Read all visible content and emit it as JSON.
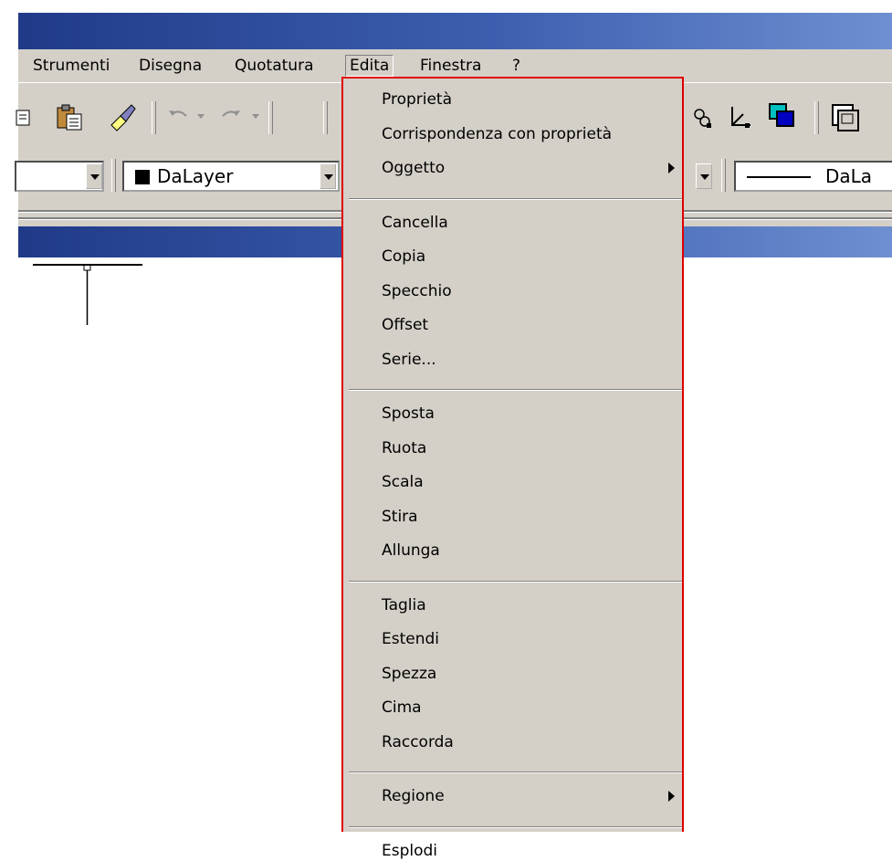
{
  "menubar": {
    "items": [
      {
        "label": "Strumenti"
      },
      {
        "label": "Disegna"
      },
      {
        "label": "Quotatura"
      },
      {
        "label": "Edita"
      },
      {
        "label": "Finestra"
      },
      {
        "label": "?"
      }
    ]
  },
  "toolbar": {
    "color_combo": "DaLayer",
    "linetype_combo": "DaLa"
  },
  "dropdown": {
    "title": "Edita",
    "groups": [
      [
        {
          "label": "Proprietà"
        },
        {
          "label": "Corrispondenza con proprietà"
        },
        {
          "label": "Oggetto",
          "submenu": true
        }
      ],
      [
        {
          "label": "Cancella"
        },
        {
          "label": "Copia"
        },
        {
          "label": "Specchio"
        },
        {
          "label": "Offset"
        },
        {
          "label": "Serie..."
        }
      ],
      [
        {
          "label": "Sposta"
        },
        {
          "label": "Ruota"
        },
        {
          "label": "Scala"
        },
        {
          "label": "Stira"
        },
        {
          "label": "Allunga"
        }
      ],
      [
        {
          "label": "Taglia"
        },
        {
          "label": "Estendi"
        },
        {
          "label": "Spezza"
        },
        {
          "label": "Cima"
        },
        {
          "label": "Raccorda"
        }
      ],
      [
        {
          "label": "Regione",
          "submenu": true
        }
      ],
      [
        {
          "label": "Esplodi"
        }
      ]
    ]
  },
  "colors": {
    "title_bar": "#203a88",
    "menu_face": "#d4d0c8",
    "highlight_border": "#e00000"
  }
}
